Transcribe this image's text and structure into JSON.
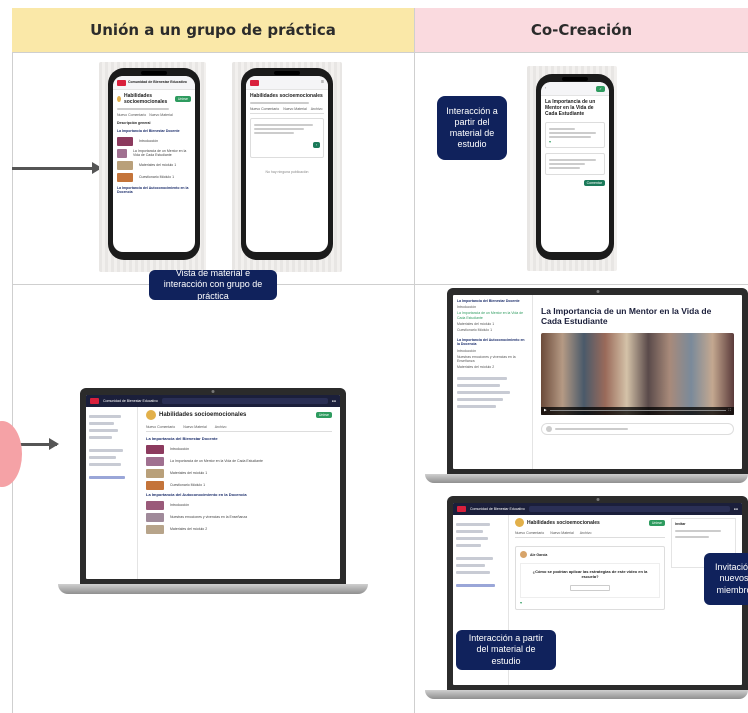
{
  "headers": {
    "left": "Unión a un grupo de práctica",
    "right": "Co-Creación"
  },
  "labels": {
    "vista_material": "Vista de material e interacción con grupo de práctica",
    "interaccion_partir": "Interacción a partir del material de estudio",
    "interaccion_partir_2": "Interacción a partir del material de estudio",
    "invitacion": "Invitación nuevos miembro"
  },
  "mockup": {
    "brand": "Comunidad de Bienestar Educativo",
    "group_title": "Habilidades socioemocionales",
    "section_1": "La Importancia del Bienestar Docente",
    "section_2": "La Importancia del Autoconocimiento en la Docencia",
    "item_intro": "Introducción",
    "item_mentor": "La Importancia de un Mentor en la Vida de Cada Estudiante",
    "item_materiales": "Materiales del módulo 1",
    "item_cuestionario": "Cuestionario Módulo 1",
    "item_nuestras": "Nuestras emociones y vivencias en la Enseñanza",
    "item_materiales_2": "Materiales del módulo 2",
    "desc_general": "Descripción general",
    "video_title": "La Importancia de un Mentor en la Vida de Cada Estudiante",
    "post_question": "¿Cómo se podrían aplicar las estrategias de este video en la escuela?",
    "author": "Ale García",
    "no_posts": "No hay ninguna publicación",
    "tab_1": "Nuevo Comentario",
    "tab_2": "Nuevo Material",
    "tab_3": "Archivo",
    "join_btn": "Unirse",
    "search_placeholder": "Buscar Habilidades socioemocionales",
    "invite_title": "Invitar"
  }
}
